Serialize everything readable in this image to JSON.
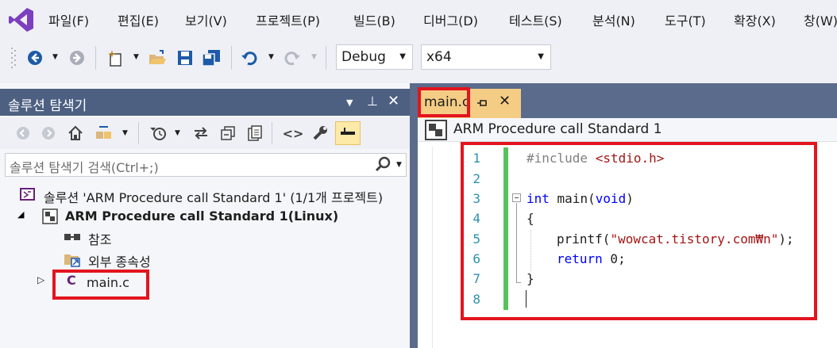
{
  "menu": {
    "items": [
      "파일(F)",
      "편집(E)",
      "보기(V)",
      "프로젝트(P)",
      "빌드(B)",
      "디버그(D)",
      "테스트(S)",
      "분석(N)",
      "도구(T)",
      "확장(X)",
      "창(W)"
    ]
  },
  "toolbar": {
    "config": "Debug",
    "platform": "x64",
    "icons": [
      "back-icon",
      "forward-icon",
      "new-project-icon",
      "open-folder-icon",
      "save-icon",
      "save-all-icon",
      "undo-icon",
      "redo-icon"
    ]
  },
  "solution_explorer": {
    "title": "솔루션 탐색기",
    "search_placeholder": "솔루션 탐색기 검색(Ctrl+;)",
    "tree": {
      "solution": "솔루션 'ARM Procedure call Standard 1' (1/1개 프로젝트)",
      "project": "ARM Procedure call Standard 1(Linux)",
      "references": "참조",
      "external_deps": "외부 종속성",
      "file": "main.c"
    }
  },
  "editor": {
    "tab": "main.c",
    "nav_scope": "ARM Procedure call Standard 1",
    "line_numbers": [
      "1",
      "2",
      "3",
      "4",
      "5",
      "6",
      "7",
      "8"
    ],
    "code": {
      "l1_directive": "#include",
      "l1_header": "<stdio.h>",
      "l3_type": "int",
      "l3_rest": " main(",
      "l3_param": "void",
      "l3_close": ")",
      "l4": "{",
      "l5_func": "printf(",
      "l5_str": "\"wowcat.tistory.com₩n\"",
      "l5_end": ");",
      "l6_kw": "return",
      "l6_rest": " 0;",
      "l7": "}"
    }
  },
  "colors": {
    "title_bar": "#4d6082",
    "tab_active": "#f5cc84",
    "highlight_box": "#e3141e",
    "change_bar": "#57c25b",
    "keyword": "#0000ff",
    "string": "#a31515"
  }
}
